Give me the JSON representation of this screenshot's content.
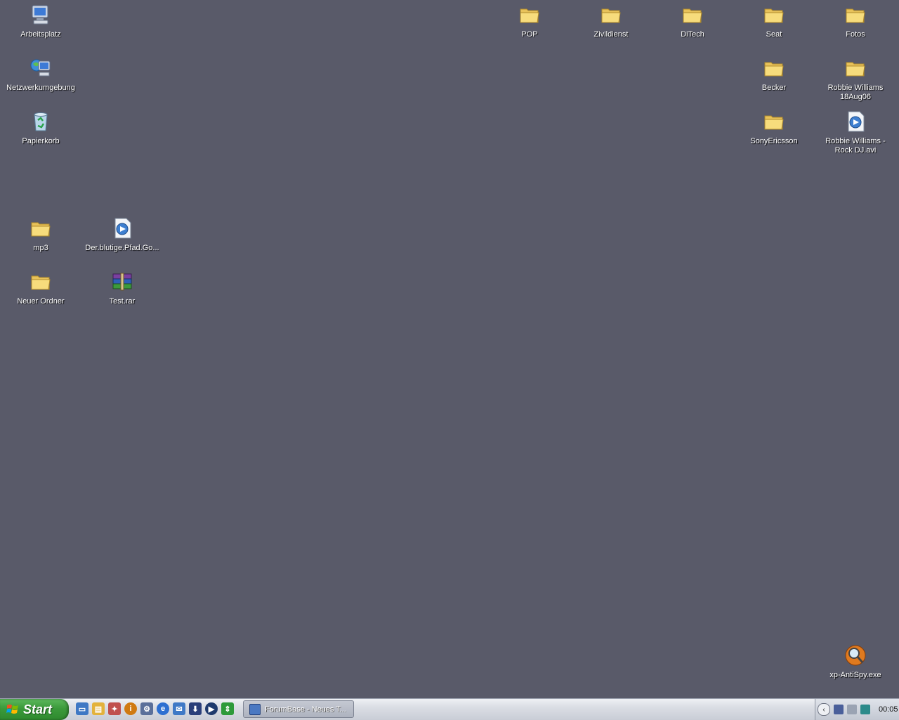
{
  "desktop": {
    "icons": {
      "arbeitsplatz": "Arbeitsplatz",
      "netzwerk": "Netzwerkumgebung",
      "papierkorb": "Papierkorb",
      "mp3": "mp3",
      "video1": "Der.blutige.Pfad.Go...",
      "neuer_ordner": "Neuer Ordner",
      "test_rar": "Test.rar",
      "pop": "POP",
      "zivildienst": "Zivildienst",
      "ditech": "DiTech",
      "seat": "Seat",
      "fotos": "Fotos",
      "becker": "Becker",
      "robbie_folder": "Robbie Williams 18Aug06",
      "sonyericsson": "SonyEricsson",
      "robbie_avi": "Robbie Williams - Rock DJ.avi",
      "antispy": "xp-AntiSpy.exe"
    }
  },
  "taskbar": {
    "start_label": "Start",
    "task_label": "ForumBase - Neues T...",
    "clock": "00:05"
  },
  "colors": {
    "desktop_bg": "#595a69",
    "start_green": "#3b9a3b"
  }
}
